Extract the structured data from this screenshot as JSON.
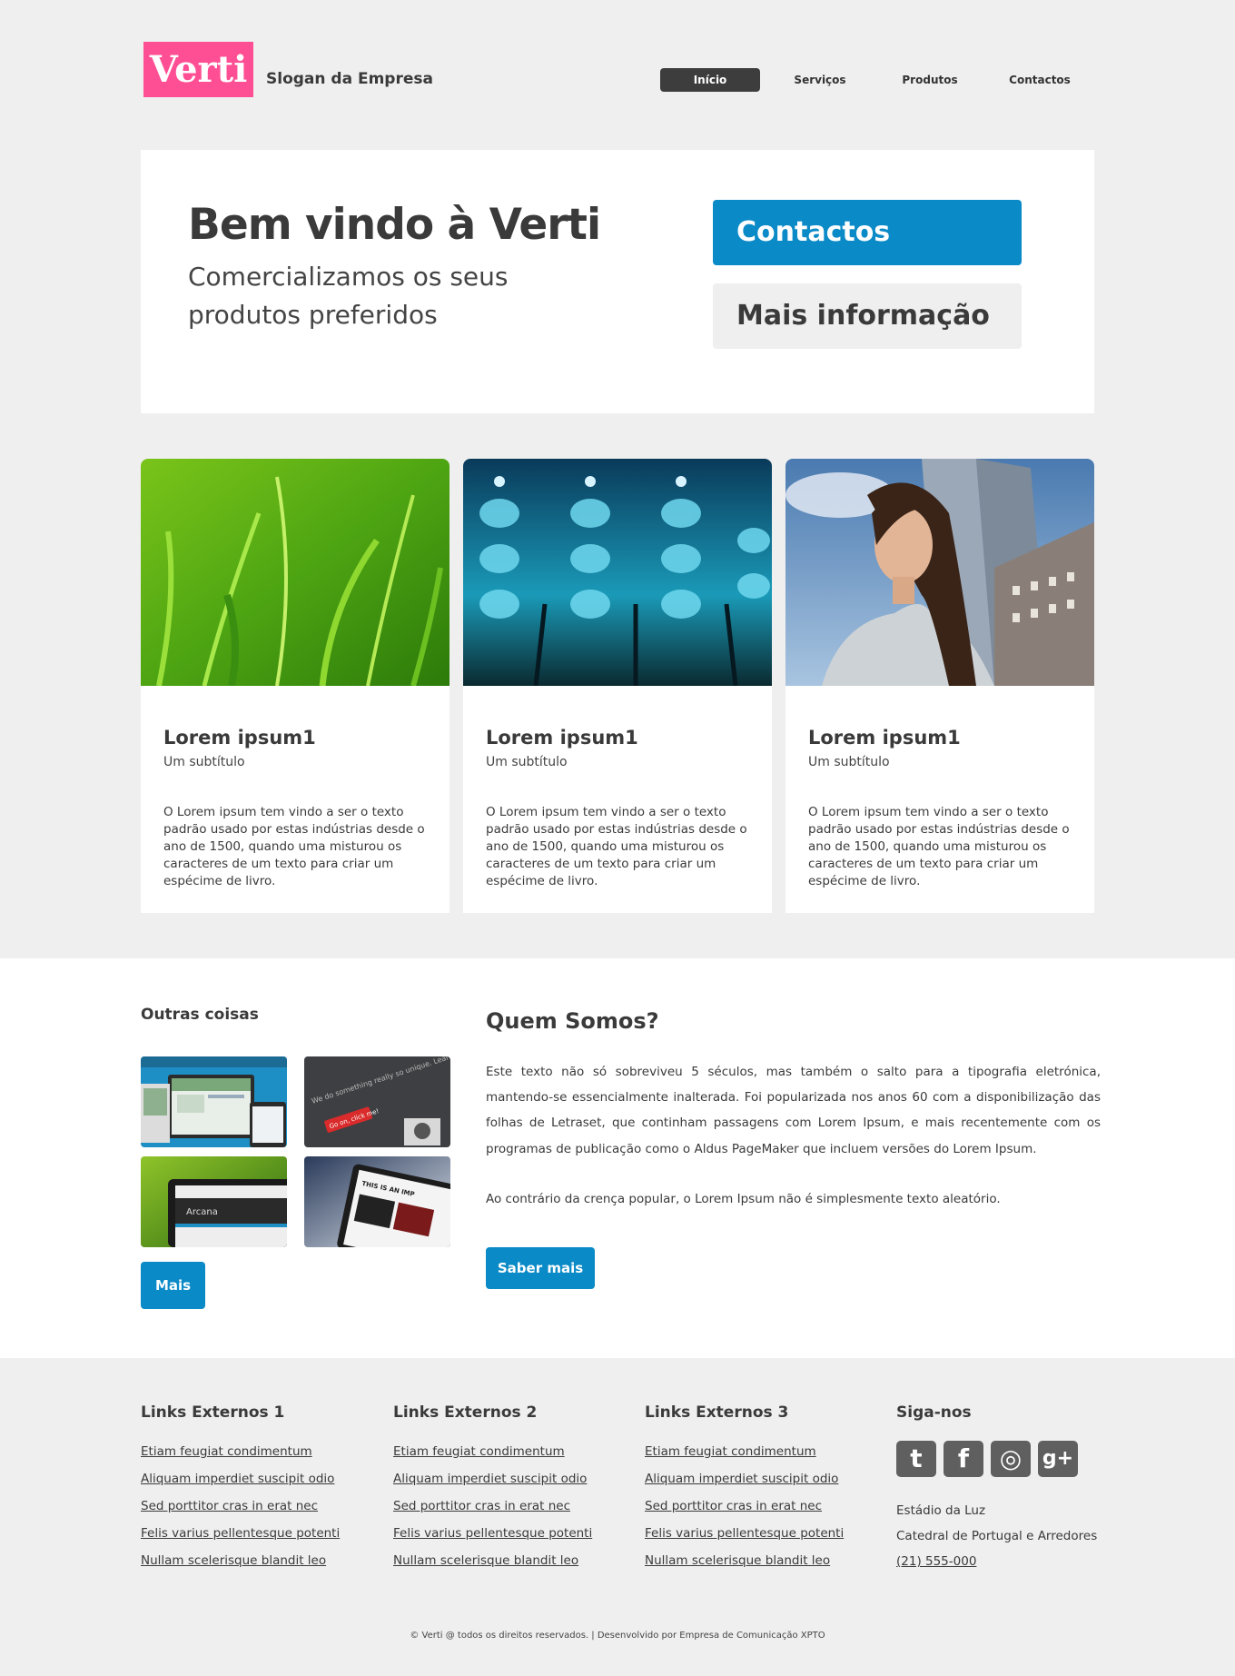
{
  "header": {
    "logo": "Verti",
    "slogan": "Slogan da Empresa",
    "nav": [
      "Início",
      "Serviços",
      "Produtos",
      "Contactos"
    ]
  },
  "hero": {
    "title": "Bem vindo à Verti",
    "subtitle_line1": "Comercializamos os seus",
    "subtitle_line2": "produtos preferidos",
    "primary_button": "Contactos",
    "secondary_button": "Mais informação"
  },
  "cards": [
    {
      "title": "Lorem ipsum1",
      "subtitle": "Um subtítulo",
      "text": "O Lorem ipsum tem vindo a ser o texto padrão usado por estas indústrias desde o ano de 1500, quando uma misturou os caracteres de um texto para criar um espécime de livro."
    },
    {
      "title": "Lorem ipsum1",
      "subtitle": "Um subtítulo",
      "text": "O Lorem ipsum tem vindo a ser o texto padrão usado por estas indústrias desde o ano de 1500, quando uma misturou os caracteres de um texto para criar um espécime de livro."
    },
    {
      "title": "Lorem ipsum1",
      "subtitle": "Um subtítulo",
      "text": "O Lorem ipsum tem vindo a ser o texto padrão usado por estas indústrias desde o ano de 1500, quando uma misturou os caracteres de um texto para criar um espécime de livro."
    }
  ],
  "outras": {
    "title": "Outras coisas",
    "thumb2_text": "We do something really so unique. Learn all about it here –",
    "thumb2_button": "Go on, click me!",
    "thumb3_text": "Arcana",
    "thumb4_text": "THIS IS AN IMP",
    "more_button": "Mais"
  },
  "quem": {
    "title": "Quem Somos?",
    "paragraph1": "Este texto não só sobreviveu 5 séculos, mas também o salto para a tipografia eletrónica, mantendo-se essencialmente inalterada. Foi popularizada nos anos 60 com a disponibilização das folhas de Letraset, que continham passagens com Lorem Ipsum, e mais recentemente com os programas de publicação como o Aldus PageMaker que incluem versões do Lorem Ipsum.",
    "paragraph2": "Ao contrário da crença popular, o Lorem Ipsum não é simplesmente texto aleatório.",
    "button": "Saber mais"
  },
  "footer": {
    "columns": [
      {
        "title": "Links Externos 1",
        "links": [
          "Etiam feugiat condimentum",
          "Aliquam imperdiet suscipit odio",
          "Sed porttitor cras in erat nec",
          "Felis varius pellentesque potenti",
          "Nullam scelerisque blandit leo"
        ]
      },
      {
        "title": "Links Externos 2",
        "links": [
          "Etiam feugiat condimentum",
          "Aliquam imperdiet suscipit odio",
          "Sed porttitor cras in erat nec",
          "Felis varius pellentesque potenti",
          "Nullam scelerisque blandit leo"
        ]
      },
      {
        "title": "Links Externos 3",
        "links": [
          "Etiam feugiat condimentum",
          "Aliquam imperdiet suscipit odio",
          "Sed porttitor cras in erat nec",
          "Felis varius pellentesque potenti",
          "Nullam scelerisque blandit leo"
        ]
      }
    ],
    "follow": {
      "title": "Siga-nos",
      "icons": [
        "twitter-icon",
        "facebook-icon",
        "dribbble-icon",
        "google-plus-icon"
      ],
      "icon_glyphs": [
        "t",
        "f",
        "◎",
        "g+"
      ],
      "address_line1": "Estádio da Luz",
      "address_line2": "Catedral de Portugal e Arredores",
      "phone": "(21) 555-000"
    },
    "copyright": "© Verti @ todos os direitos reservados. | Desenvolvido por Empresa de Comunicação XPTO"
  },
  "colors": {
    "accent": "#0a8ac7",
    "logo": "#ff4f94",
    "background": "#efefef",
    "nav_active": "#3d3d3d"
  }
}
